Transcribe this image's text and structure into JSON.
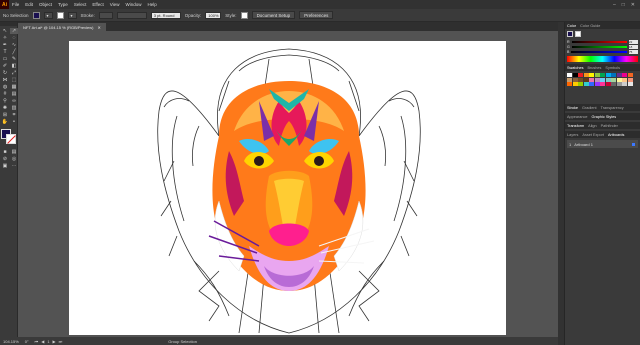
{
  "app": {
    "logo": "Ai"
  },
  "menu": [
    "File",
    "Edit",
    "Object",
    "Type",
    "Select",
    "Effect",
    "View",
    "Window",
    "Help"
  ],
  "window_controls": [
    "–",
    "□",
    "✕"
  ],
  "control_bar": {
    "selection_label": "No Selection",
    "stroke_label": "Stroke:",
    "brush_value": "3 pt. Round",
    "opacity_label": "Opacity:",
    "opacity_value": "100%",
    "style_label": "Style:",
    "document_setup": "Document Setup",
    "preferences": "Preferences",
    "fill_color": "#1a1050"
  },
  "document_tab": {
    "title": "NFT Art.ai* @ 104.15 % (RGB/Preview)",
    "close": "✕"
  },
  "status_bar": {
    "zoom": "104.15%",
    "rotation": "0°",
    "artboard_num": "1",
    "tool": "Group Selection"
  },
  "panels": {
    "color_tabs": [
      "Color",
      "Color Guide"
    ],
    "channels": [
      {
        "label": "R",
        "value": "22",
        "gradient": "linear-gradient(to right,#000,#f00)"
      },
      {
        "label": "G",
        "value": "18",
        "gradient": "linear-gradient(to right,#000,#0f0)"
      },
      {
        "label": "B",
        "value": "75",
        "gradient": "linear-gradient(to right,#000,#00f)"
      }
    ],
    "swatches_tabs": [
      "Swatches",
      "Brushes",
      "Symbols"
    ],
    "swatch_colors": [
      "#ffffff",
      "#000000",
      "#ed1c24",
      "#f7941d",
      "#fff200",
      "#8dc63f",
      "#00a651",
      "#00aeef",
      "#0072bc",
      "#662d91",
      "#ec008c",
      "#f26522",
      "#c69c6d",
      "#8c6239",
      "#754c24",
      "#603913",
      "#f06eaa",
      "#bd8cbf",
      "#6dcff6",
      "#7accc8",
      "#a3d39c",
      "#fff799",
      "#fdc689",
      "#f69679",
      "#ff6600",
      "#ffcc00",
      "#99cc00",
      "#33cccc",
      "#3366ff",
      "#9933ff",
      "#ff3399",
      "#cc0033",
      "#666666",
      "#999999",
      "#cccccc",
      "#e6e6e6"
    ],
    "stroke_tabs": [
      "Stroke",
      "Gradient",
      "Transparency"
    ],
    "appearance_tabs": [
      "Appearance",
      "Graphic Styles"
    ],
    "transform_tabs": [
      "Transform",
      "Align",
      "Pathfinder"
    ],
    "layers_tabs": [
      "Layers",
      "Asset Export",
      "Artboards"
    ],
    "artboard_row": {
      "num": "1",
      "name": "Artboard 1"
    }
  }
}
